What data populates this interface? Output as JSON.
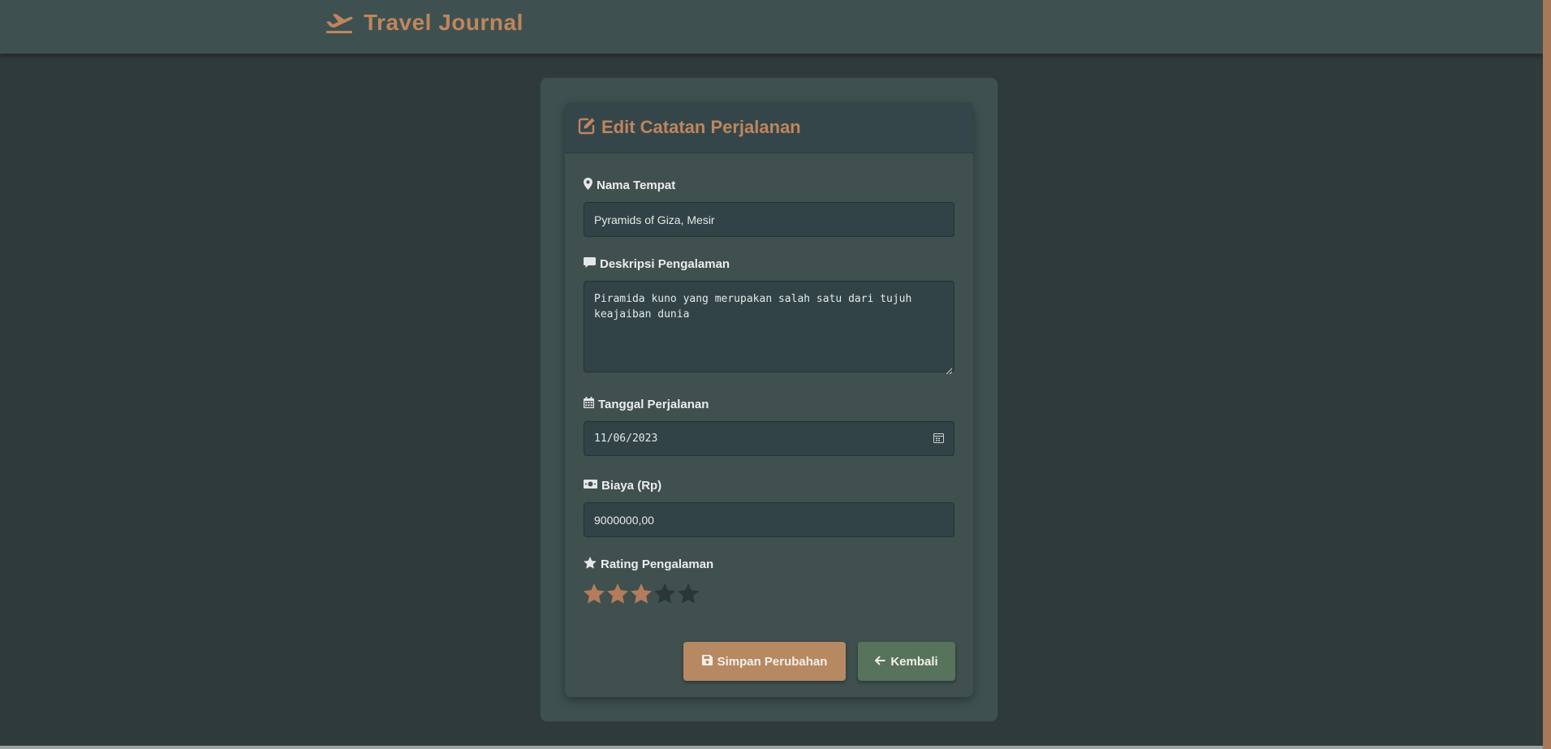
{
  "app": {
    "title": "Travel Journal",
    "brand_icon": "plane-departure-icon",
    "colors": {
      "accent": "#c0855d",
      "navbar": "#3e5150",
      "background": "#2f3a3b",
      "save_button": "#b78962",
      "back_button": "#58735b",
      "star_filled": "#b47c5a",
      "star_empty": "#2a3637"
    }
  },
  "form": {
    "header_title": "Edit Catatan Perjalanan",
    "place": {
      "label": "Nama Tempat",
      "value": "Pyramids of Giza, Mesir"
    },
    "description": {
      "label": "Deskripsi Pengalaman",
      "value": "Piramida kuno yang merupakan salah satu dari tujuh keajaiban dunia"
    },
    "date": {
      "label": "Tanggal Perjalanan",
      "value": "11/06/2023"
    },
    "cost": {
      "label": "Biaya (Rp)",
      "value": "9000000,00"
    },
    "rating": {
      "label": "Rating Pengalaman",
      "value": 3,
      "max": 5
    },
    "buttons": {
      "save_label": "Simpan Perubahan",
      "back_label": "Kembali"
    }
  }
}
